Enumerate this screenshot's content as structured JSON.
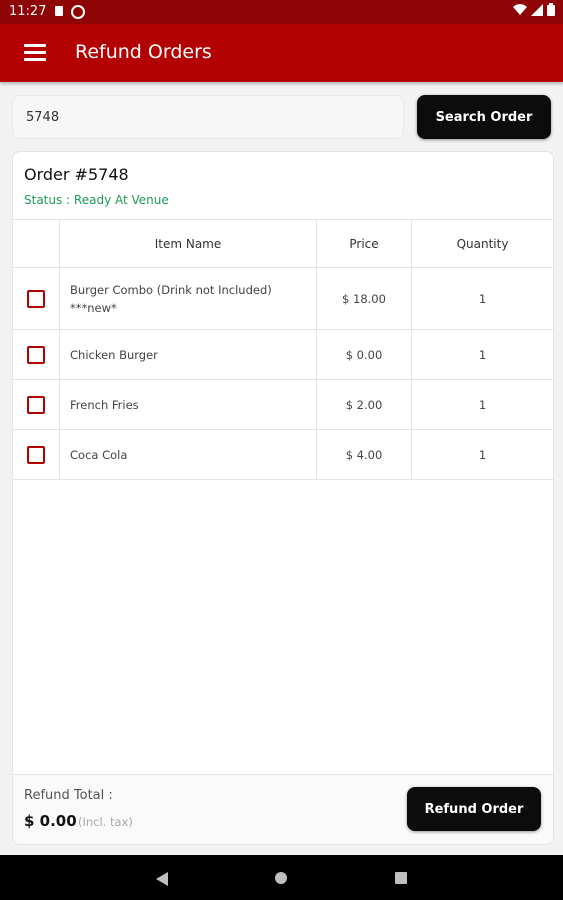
{
  "status_bar": {
    "time": "11:27",
    "icons": [
      "sim-card-icon",
      "data-saver-icon",
      "wifi-icon",
      "signal-icon",
      "battery-icon"
    ]
  },
  "app_bar": {
    "title": "Refund Orders",
    "menu_icon": "hamburger-menu-icon"
  },
  "search": {
    "value": "5748",
    "button_label": "Search Order"
  },
  "order": {
    "title": "Order #5748",
    "status": "Status : Ready At Venue",
    "columns": {
      "item_name": "Item Name",
      "price": "Price",
      "quantity": "Quantity"
    },
    "items": [
      {
        "name": "Burger Combo (Drink not Included) ***new*",
        "price": "$ 18.00",
        "quantity": "1",
        "checked": false
      },
      {
        "name": "Chicken Burger",
        "price": "$ 0.00",
        "quantity": "1",
        "checked": false
      },
      {
        "name": "French Fries",
        "price": "$ 2.00",
        "quantity": "1",
        "checked": false
      },
      {
        "name": "Coca Cola",
        "price": "$ 4.00",
        "quantity": "1",
        "checked": false
      }
    ]
  },
  "footer": {
    "refund_total_label": "Refund Total :",
    "refund_amount": "$ 0.00",
    "tax_note": "(Incl. tax)",
    "refund_button_label": "Refund Order"
  },
  "colors": {
    "app_bar": "#b30000",
    "status_bar": "#8f0505",
    "status_text": "#1e9a5c",
    "checkbox": "#b30000",
    "button": "#0c0c0c"
  }
}
